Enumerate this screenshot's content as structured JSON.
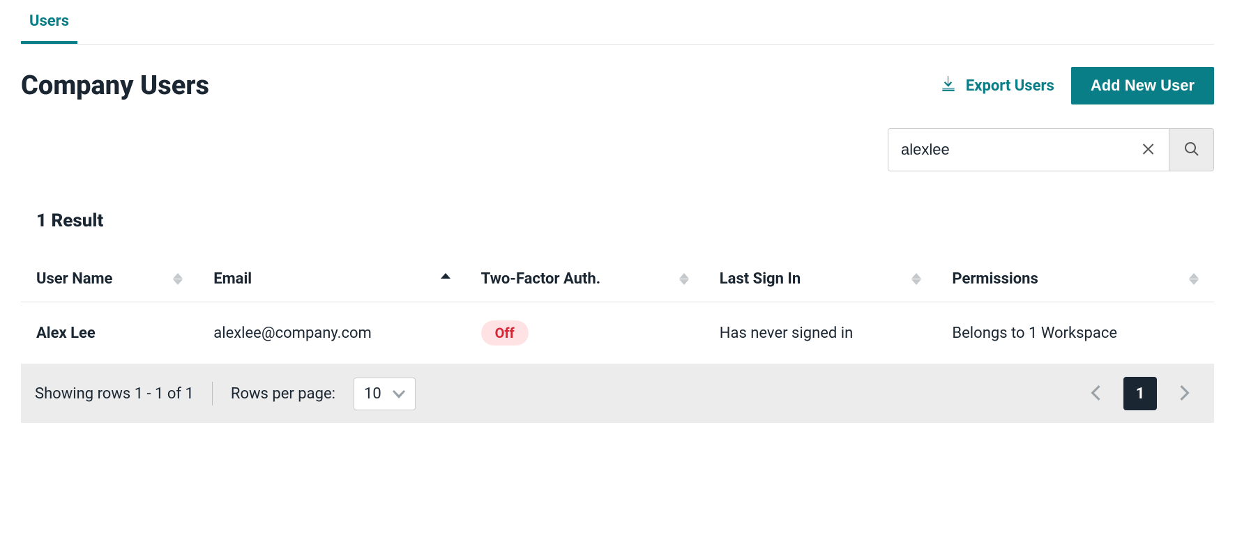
{
  "tabs": {
    "active": "Users"
  },
  "header": {
    "title": "Company Users",
    "export_label": "Export Users",
    "add_label": "Add New User"
  },
  "search": {
    "value": "alexlee"
  },
  "results": {
    "count_label": "1 Result"
  },
  "columns": {
    "user_name": "User Name",
    "email": "Email",
    "tfa": "Two-Factor Auth.",
    "last_sign_in": "Last Sign In",
    "permissions": "Permissions"
  },
  "rows": [
    {
      "user_name": "Alex Lee",
      "email": "alexlee@company.com",
      "tfa": "Off",
      "last_sign_in": "Has never signed in",
      "permissions": "Belongs to 1 Workspace"
    }
  ],
  "footer": {
    "showing": "Showing rows 1 - 1 of 1",
    "rows_label": "Rows per page:",
    "rows_value": "10",
    "page": "1"
  }
}
